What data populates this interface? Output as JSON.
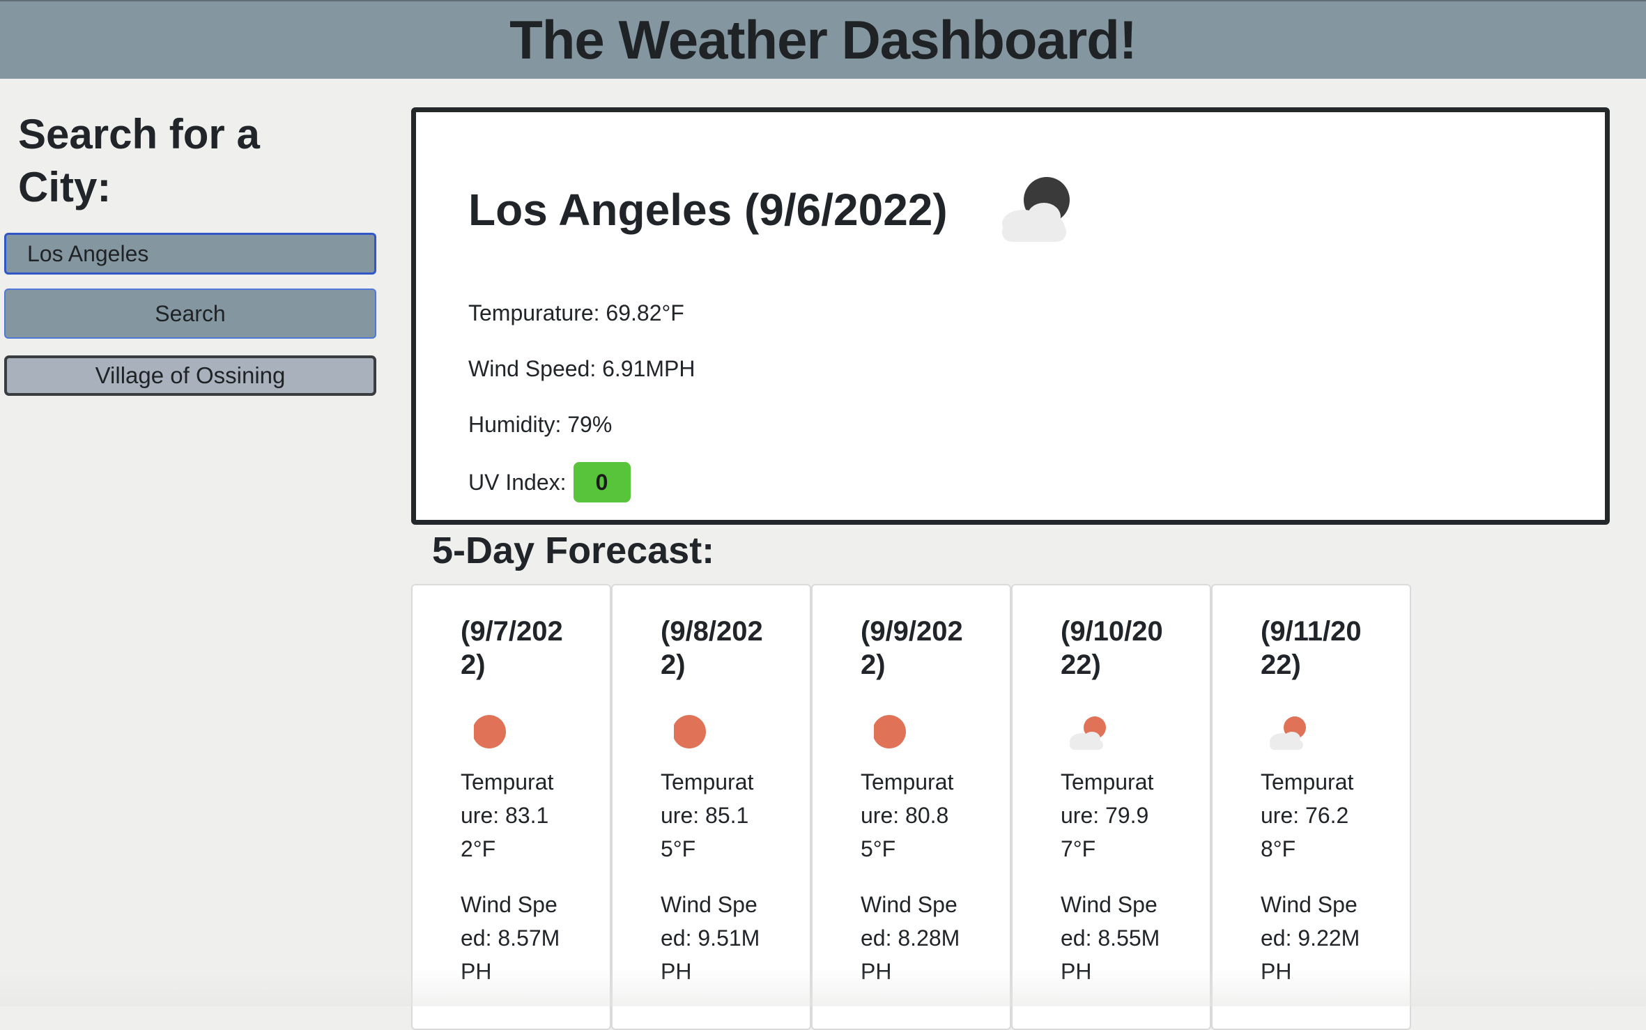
{
  "header": {
    "title": "The Weather Dashboard!"
  },
  "sidebar": {
    "title": "Search for a City:",
    "search_input_value": "Los Angeles",
    "search_button_label": "Search",
    "history": [
      {
        "label": "Village of Ossining"
      }
    ]
  },
  "current": {
    "title": "Los Angeles (9/6/2022)",
    "icon": "cloud-moon-icon",
    "temperature": "Tempurature: 69.82°F",
    "wind": "Wind Speed: 6.91MPH",
    "humidity": "Humidity: 79%",
    "uv_label": "UV Index:",
    "uv_value": "0",
    "uv_color": "#57c43b"
  },
  "forecast": {
    "title": "5-Day Forecast:",
    "days": [
      {
        "date": "(9/7/2022)",
        "icon": "sun-icon",
        "temp": "Tempurature: 83.12°F",
        "wind": "Wind Speed: 8.57MPH"
      },
      {
        "date": "(9/8/2022)",
        "icon": "sun-icon",
        "temp": "Tempurature: 85.15°F",
        "wind": "Wind Speed: 9.51MPH"
      },
      {
        "date": "(9/9/2022)",
        "icon": "sun-icon",
        "temp": "Tempurature: 80.85°F",
        "wind": "Wind Speed: 8.28MPH"
      },
      {
        "date": "(9/10/2022)",
        "icon": "cloud-sun-icon",
        "temp": "Tempurature: 79.97°F",
        "wind": "Wind Speed: 8.55MPH"
      },
      {
        "date": "(9/11/2022)",
        "icon": "cloud-sun-icon",
        "temp": "Tempurature: 76.28°F",
        "wind": "Wind Speed: 9.22MPH"
      }
    ]
  },
  "colors": {
    "header_bg": "#84969f",
    "sun": "#e07357",
    "moon": "#3a3a3a",
    "cloud": "#ececec"
  }
}
